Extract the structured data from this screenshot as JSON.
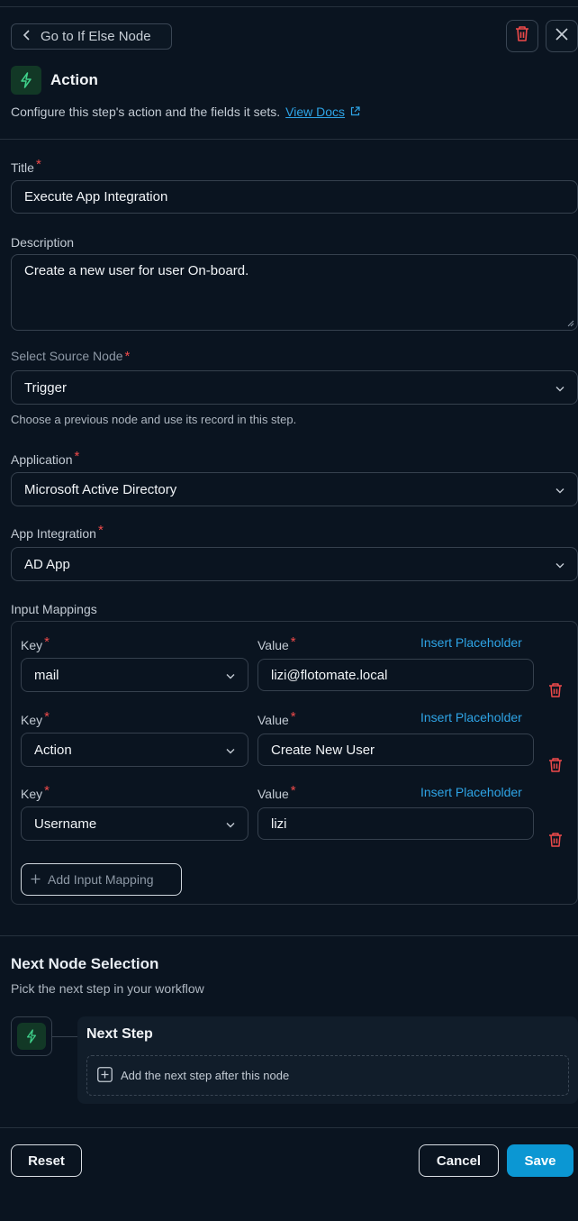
{
  "header": {
    "back_label": "Go to If Else Node",
    "title": "Action",
    "subtitle": "Configure this step's action and the fields it sets.",
    "docs_link": "View Docs"
  },
  "form": {
    "title_label": "Title",
    "title_value": "Execute App Integration",
    "description_label": "Description",
    "description_value": "Create a new user for user On-board.",
    "source_label": "Select Source Node",
    "source_value": "Trigger",
    "source_help": "Choose a previous node and use its record in this step.",
    "application_label": "Application",
    "application_value": "Microsoft Active Directory",
    "integration_label": "App Integration",
    "integration_value": "AD App",
    "mappings_label": "Input Mappings",
    "required_mark": "*"
  },
  "mappings": {
    "key_label": "Key",
    "value_label": "Value",
    "insert_label": "Insert Placeholder",
    "add_label": "Add Input Mapping",
    "rows": [
      {
        "key": "mail",
        "value": "lizi@flotomate.local"
      },
      {
        "key": "Action",
        "value": "Create New User"
      },
      {
        "key": "Username",
        "value": "lizi"
      }
    ]
  },
  "next": {
    "section_title": "Next Node Selection",
    "section_sub": "Pick the next step in your workflow",
    "card_title": "Next Step",
    "add_label": "Add the next step after this node"
  },
  "footer": {
    "reset": "Reset",
    "cancel": "Cancel",
    "save": "Save"
  },
  "colors": {
    "background": "#0a1420",
    "accent": "#0b97d3",
    "link": "#2ea4e6",
    "danger": "#ef4a4a",
    "action_icon": "#3fd08a"
  },
  "icons": {
    "back": "chevron-left-icon",
    "delete": "trash-icon",
    "close": "close-icon",
    "action": "lightning-icon",
    "external": "external-link-icon",
    "dropdown": "chevron-down-icon",
    "add": "plus-icon"
  }
}
